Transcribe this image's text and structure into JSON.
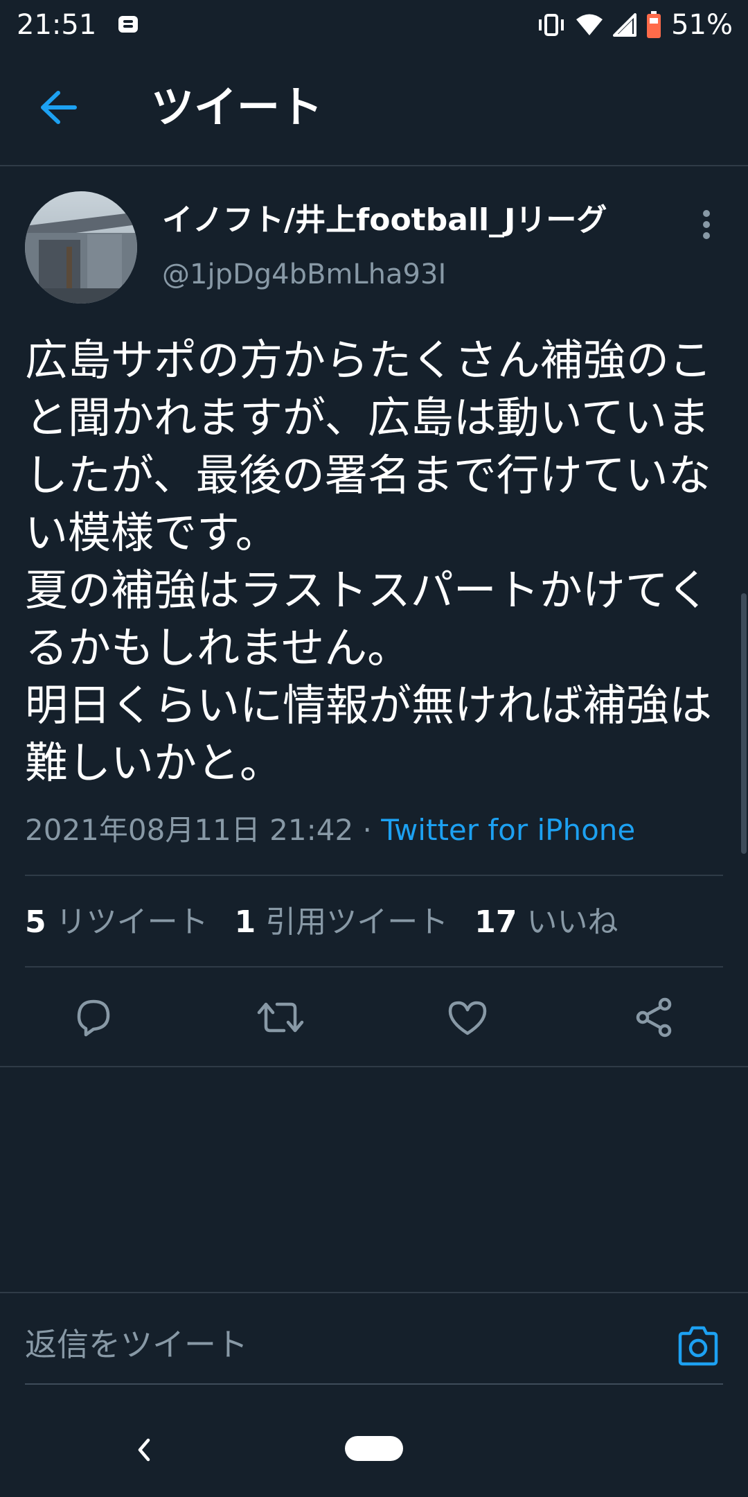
{
  "status_bar": {
    "time": "21:51",
    "battery": "51%",
    "icons": [
      "notification-icon",
      "vibrate-icon",
      "wifi-icon",
      "signal-icon",
      "battery-icon"
    ]
  },
  "header": {
    "title": "ツイート",
    "back_icon": "arrow-left-icon"
  },
  "tweet": {
    "display_name": "イノフト/井上football_Jリーグ",
    "handle": "@1jpDg4bBmLha93I",
    "text": "広島サポの方からたくさん補強のこと聞かれますが、広島は動いていましたが、最後の署名まで行けていない模様です。\n夏の補強はラストスパートかけてくるかもしれません。\n明日くらいに情報が無ければ補強は難しいかと。",
    "timestamp": "2021年08月11日 21:42",
    "separator": "·",
    "source": "Twitter for iPhone"
  },
  "stats": {
    "retweets_count": "5",
    "retweets_label": "リツイート",
    "quotes_count": "1",
    "quotes_label": "引用ツイート",
    "likes_count": "17",
    "likes_label": "いいね"
  },
  "actions": [
    "reply-icon",
    "retweet-icon",
    "like-icon",
    "share-icon"
  ],
  "reply_bar": {
    "placeholder": "返信をツイート",
    "camera_icon": "camera-icon"
  },
  "colors": {
    "background": "#15202b",
    "accent": "#1da1f2",
    "secondary_text": "#8899a6",
    "divider": "#2f3b47"
  }
}
